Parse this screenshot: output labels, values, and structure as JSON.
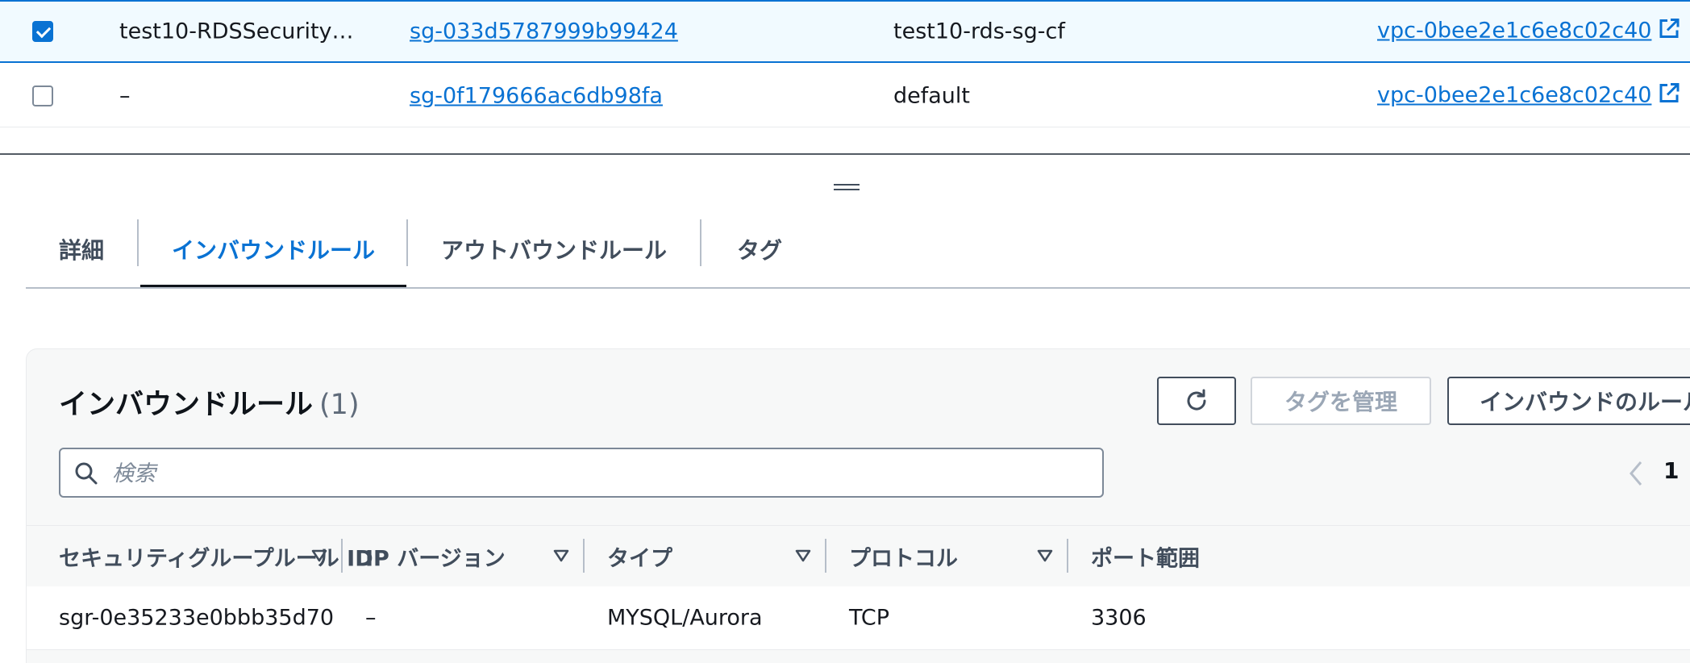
{
  "security_groups": [
    {
      "selected": true,
      "name": "test10-RDSSecurity…",
      "group_id": "sg-033d5787999b99424",
      "group_name": "test10-rds-sg-cf",
      "vpc_id": "vpc-0bee2e1c6e8c02c40"
    },
    {
      "selected": false,
      "name": "–",
      "group_id": "sg-0f179666ac6db98fa",
      "group_name": "default",
      "vpc_id": "vpc-0bee2e1c6e8c02c40"
    }
  ],
  "tabs": [
    {
      "label": "詳細",
      "active": false
    },
    {
      "label": "インバウンドルール",
      "active": true
    },
    {
      "label": "アウトバウンドルール",
      "active": false
    },
    {
      "label": "タグ",
      "active": false
    }
  ],
  "inbound_panel": {
    "title": "インバウンドルール",
    "count": "(1)",
    "manage_tags_label": "タグを管理",
    "edit_rules_label": "インバウンドのルールを編集",
    "search_placeholder": "検索",
    "current_page": "1",
    "columns": [
      "セキュリティグループルール ID",
      "IP バージョン",
      "タイプ",
      "プロトコル",
      "ポート範囲"
    ],
    "rows": [
      [
        "sgr-0e35233e0bbb35d70",
        "–",
        "MYSQL/Aurora",
        "TCP",
        "3306"
      ]
    ]
  },
  "icons": {
    "checkbox_checked": "checkbox-checked-icon",
    "external_link": "external-link-icon",
    "refresh": "refresh-icon",
    "search": "search-icon",
    "sort": "sort-down-icon",
    "pager_prev": "chevron-left-icon"
  },
  "colors": {
    "link": "#0972d3",
    "selected_row_bg": "#f1faff",
    "active_tab": "#0972d3",
    "panel_bg": "#f7f8f8"
  }
}
